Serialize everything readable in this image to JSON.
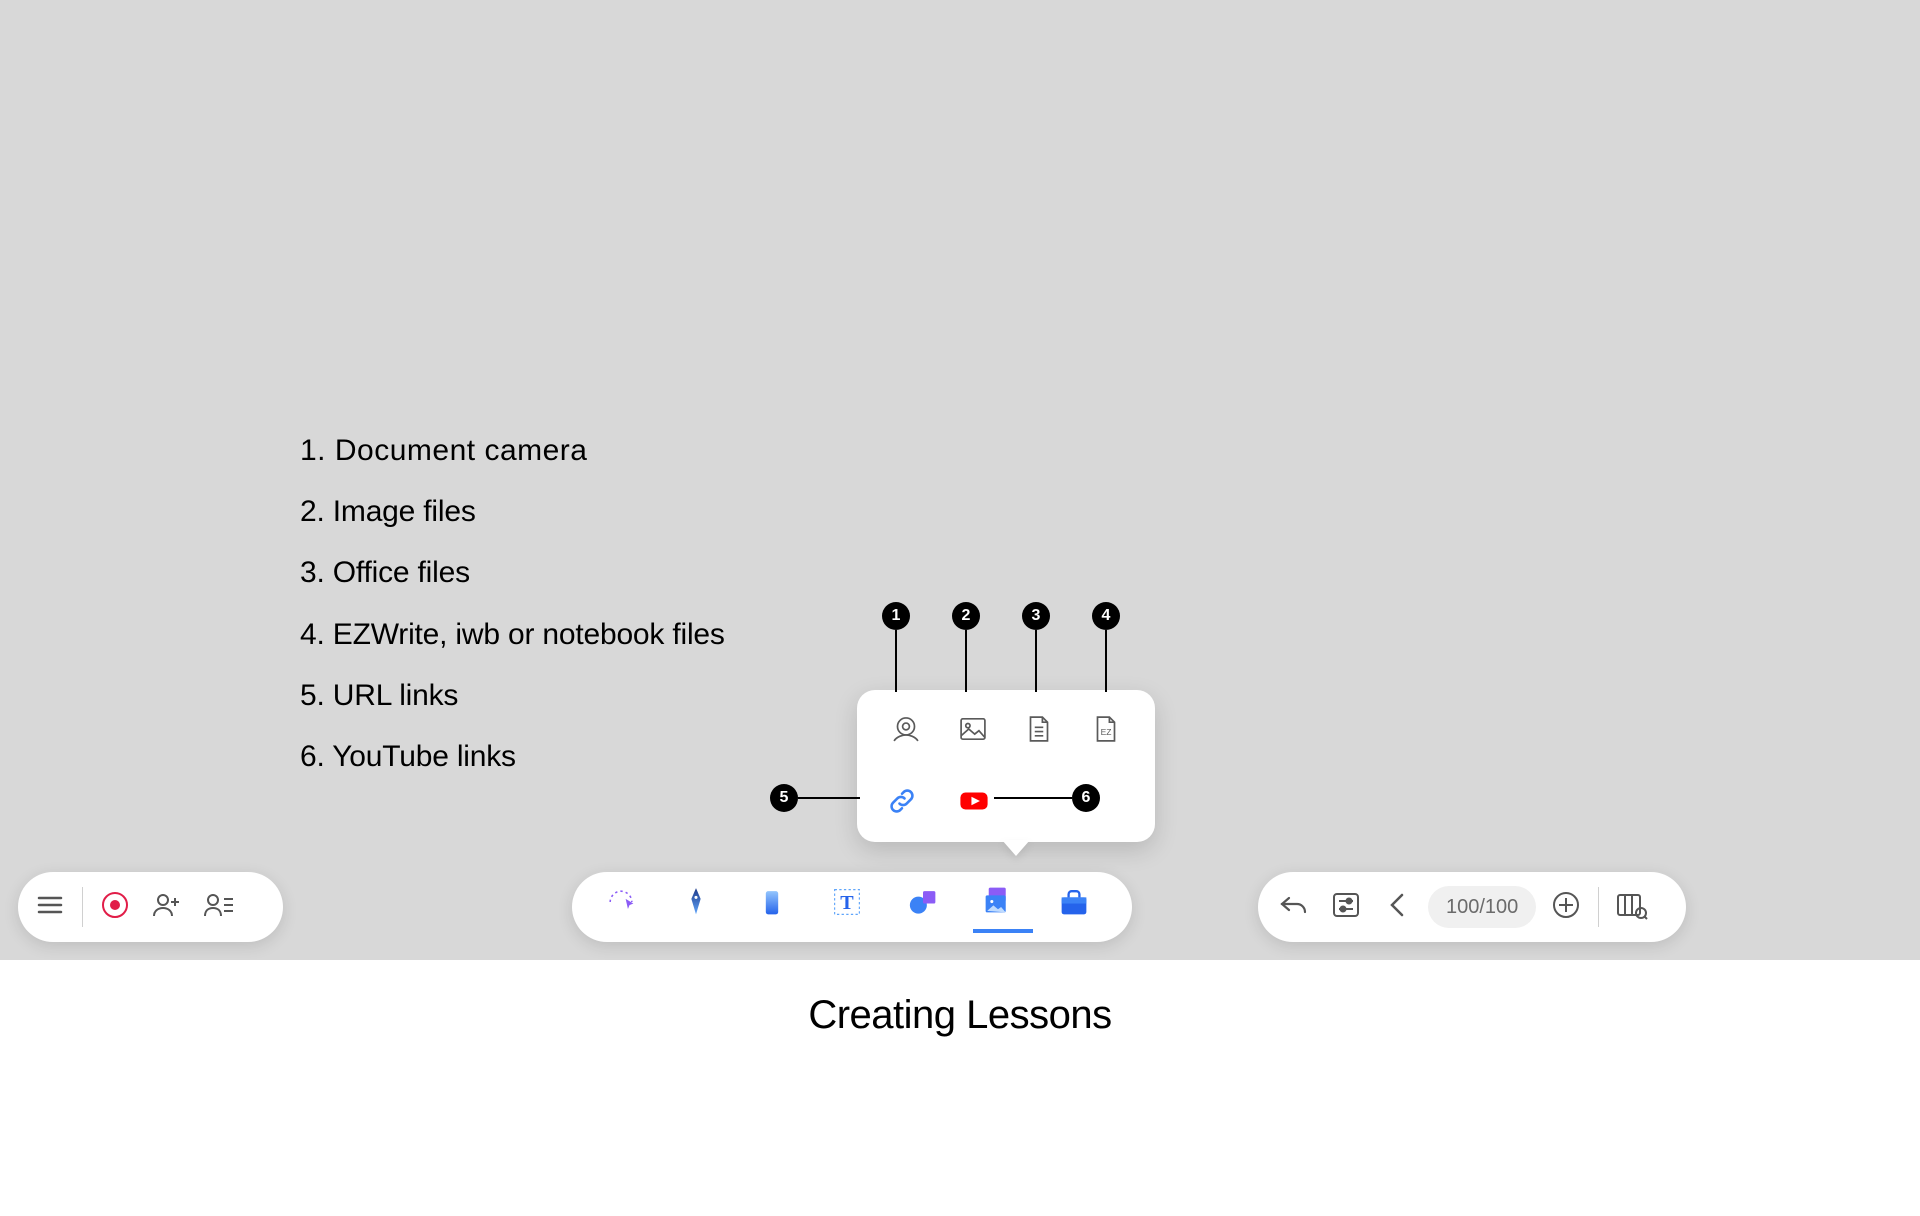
{
  "canvas": {
    "legend": {
      "items": [
        {
          "num": "1.",
          "label": " Document camera"
        },
        {
          "num": "2.",
          "label": "Image files"
        },
        {
          "num": "3.",
          "label": "Office files"
        },
        {
          "num": "4.",
          "label": "EZWrite, iwb or notebook files"
        },
        {
          "num": "5.",
          "label": "URL links"
        },
        {
          "num": "6.",
          "label": "YouTube links"
        }
      ]
    },
    "import_popover": {
      "row1": [
        {
          "name": "document-camera",
          "label": "Document camera"
        },
        {
          "name": "image-file",
          "label": "Image files"
        },
        {
          "name": "office-file",
          "label": "Office files"
        },
        {
          "name": "ezwrite-file",
          "label": "EZWrite, iwb or notebook files",
          "badge_text": "EZ"
        }
      ],
      "row2": [
        {
          "name": "url-link",
          "label": "URL links"
        },
        {
          "name": "youtube-link",
          "label": "YouTube links"
        }
      ]
    },
    "callouts": [
      {
        "n": "1"
      },
      {
        "n": "2"
      },
      {
        "n": "3"
      },
      {
        "n": "4"
      },
      {
        "n": "5"
      },
      {
        "n": "6"
      }
    ]
  },
  "toolbars": {
    "left": {
      "menu": "Menu",
      "record": "Record",
      "add_user": "Add user",
      "user_list": "User list"
    },
    "center": {
      "select": "Select",
      "pen": "Pen",
      "eraser": "Eraser",
      "text": "Text",
      "shapes": "Shapes",
      "import": "Import",
      "tools": "Tools"
    },
    "right": {
      "undo": "Undo",
      "settings": "Settings",
      "prev_page": "Previous page",
      "page_indicator": "100/100",
      "add_page": "Add page",
      "page_sorter": "Page sorter"
    }
  },
  "caption": "Creating Lessons"
}
